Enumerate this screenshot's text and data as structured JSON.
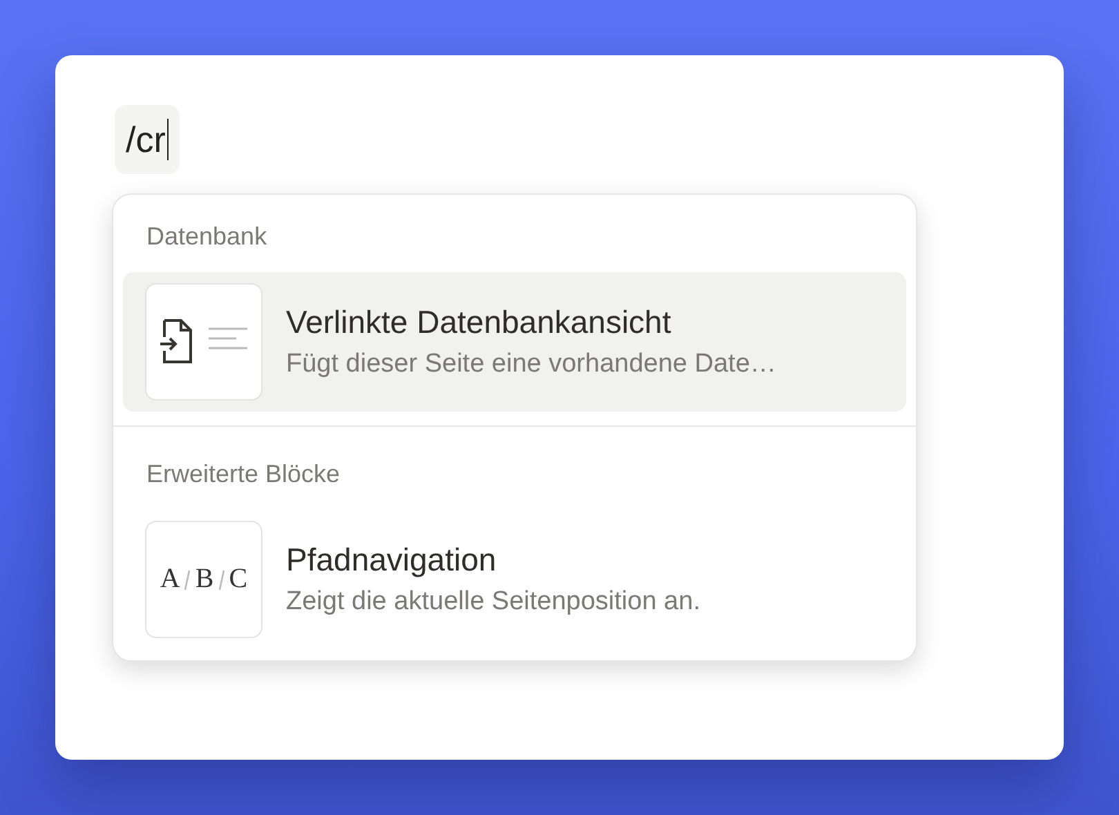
{
  "editor": {
    "typed_text": "/cr"
  },
  "menu": {
    "sections": [
      {
        "title": "Datenbank",
        "items": [
          {
            "kind": "linked-database",
            "title": "Verlinkte Datenbankansicht",
            "description": "Fügt dieser Seite eine vorhandene Date…",
            "selected": true
          }
        ]
      },
      {
        "title": "Erweiterte Blöcke",
        "items": [
          {
            "kind": "breadcrumb",
            "title": "Pfadnavigation",
            "description": "Zeigt die aktuelle Seitenposition an.",
            "icon_letters": [
              "A",
              "B",
              "C"
            ],
            "selected": false
          }
        ]
      }
    ]
  }
}
